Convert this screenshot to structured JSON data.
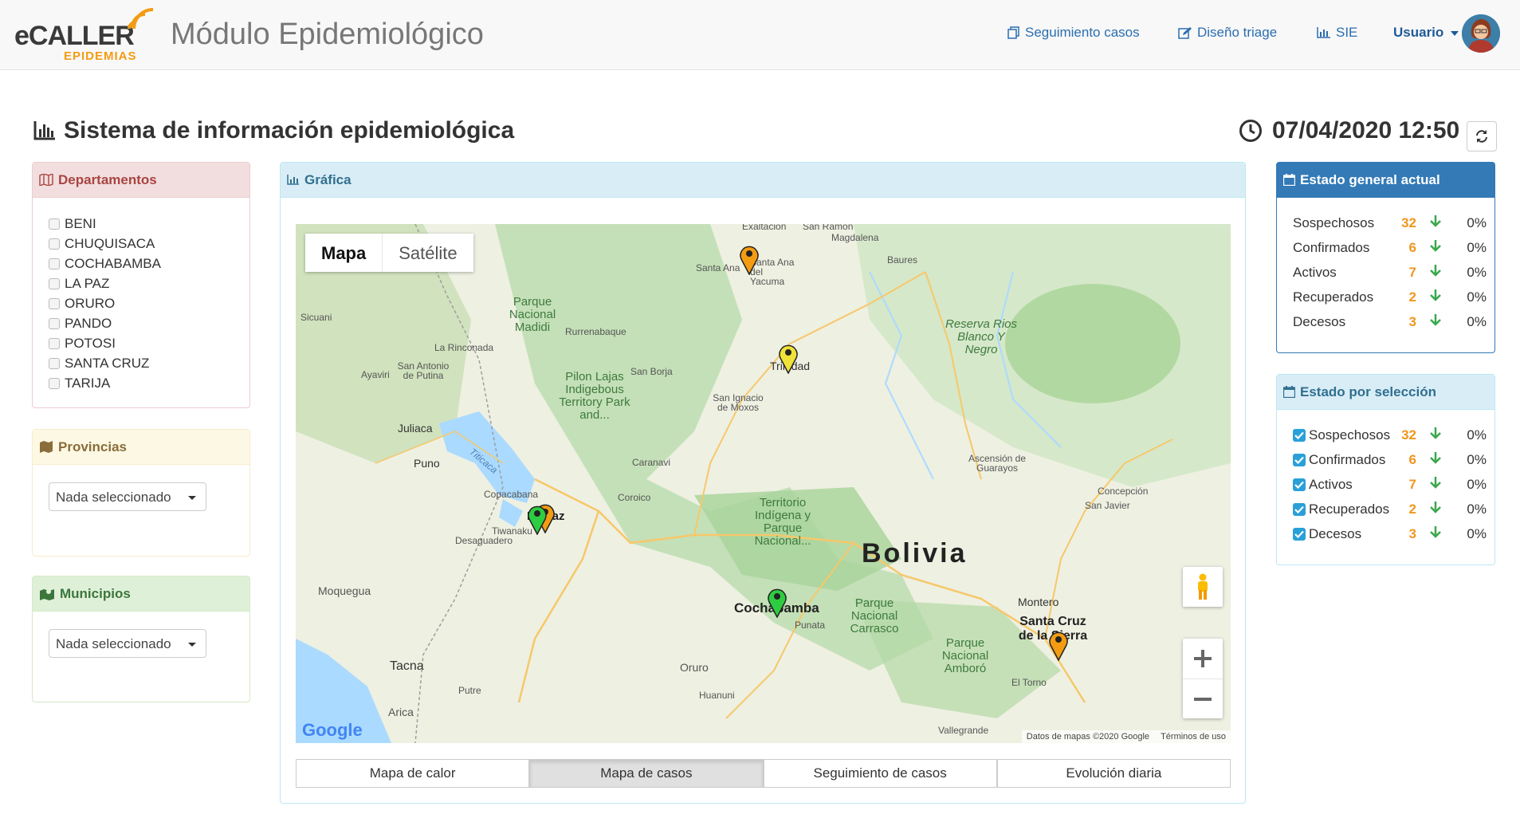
{
  "header": {
    "logo_text": "eCALLER",
    "logo_sub": "EPIDEMIAS",
    "app_title": "Módulo Epidemiológico",
    "nav": [
      {
        "label": "Seguimiento casos",
        "icon": "copy-icon"
      },
      {
        "label": "Diseño triage",
        "icon": "edit-icon"
      },
      {
        "label": "SIE",
        "icon": "bar-chart-icon"
      }
    ],
    "user_label": "Usuario"
  },
  "page": {
    "title": "Sistema de información epidemiológica",
    "datetime": "07/04/2020 12:50"
  },
  "departamentos": {
    "title": "Departamentos",
    "items": [
      "BENI",
      "CHUQUISACA",
      "COCHABAMBA",
      "LA PAZ",
      "ORURO",
      "PANDO",
      "POTOSI",
      "SANTA CRUZ",
      "TARIJA"
    ]
  },
  "provincias": {
    "title": "Provincias",
    "placeholder": "Nada seleccionado"
  },
  "municipios": {
    "title": "Municipios",
    "placeholder": "Nada seleccionado"
  },
  "grafica": {
    "title": "Gráfica",
    "map_types": [
      "Mapa",
      "Satélite"
    ],
    "map_country_label": "Bolivia",
    "map_attribution": "Datos de mapas ©2020 Google",
    "map_terms": "Términos de uso",
    "google_logo": "Google",
    "place_labels": [
      "Santa Ana",
      "Santa Ana del Yacuma",
      "Magdalena",
      "Baures",
      "Trinidad",
      "San Borja",
      "San Ignacio de Moxos",
      "Reserva Rios Blanco Y Negro",
      "Parque Nacional Madidi",
      "Rurrenabaque",
      "Sicuani",
      "La Rinconada",
      "San Antonio de Putina",
      "Ayaviri",
      "Juliaca",
      "Puno",
      "Titicaca",
      "Pilon Lajas Indigebous Territory Park and...",
      "Caranavi",
      "Coroico",
      "Copacabana",
      "La Paz",
      "Tiwanaku",
      "Desaguadero",
      "Territorio Indígena y Parque Nacional...",
      "Cochabamba",
      "Punata",
      "Parque Nacional Carrasco",
      "Parque Nacional Amboró",
      "Santa Cruz de la Sierra",
      "Montero",
      "El Torno",
      "Ascensión de Guarayos",
      "Concepción",
      "San Javier",
      "Moquegua",
      "Tacna",
      "Arica",
      "Putre",
      "Oruro",
      "Huanuni",
      "Vallegrande",
      "Exaltación",
      "San Ramón"
    ],
    "markers": [
      {
        "place": "Santa Ana",
        "color": "#f39c12"
      },
      {
        "place": "Trinidad",
        "color": "#f1e23a"
      },
      {
        "place": "La Paz",
        "color": "#f39c12"
      },
      {
        "place": "La Paz",
        "color": "#2ecc40"
      },
      {
        "place": "Cochabamba",
        "color": "#2ecc40"
      },
      {
        "place": "Santa Cruz de la Sierra",
        "color": "#f39c12"
      }
    ],
    "tabs": [
      "Mapa de calor",
      "Mapa de casos",
      "Seguimiento de casos",
      "Evolución diaria"
    ],
    "active_tab": "Mapa de casos"
  },
  "estado_general": {
    "title": "Estado general actual",
    "rows": [
      {
        "label": "Sospechosos",
        "value": "32",
        "pct": "0%"
      },
      {
        "label": "Confirmados",
        "value": "6",
        "pct": "0%"
      },
      {
        "label": "Activos",
        "value": "7",
        "pct": "0%"
      },
      {
        "label": "Recuperados",
        "value": "2",
        "pct": "0%"
      },
      {
        "label": "Decesos",
        "value": "3",
        "pct": "0%"
      }
    ]
  },
  "estado_seleccion": {
    "title": "Estado por selección",
    "rows": [
      {
        "label": "Sospechosos",
        "value": "32",
        "pct": "0%",
        "checked": true
      },
      {
        "label": "Confirmados",
        "value": "6",
        "pct": "0%",
        "checked": true
      },
      {
        "label": "Activos",
        "value": "7",
        "pct": "0%",
        "checked": true
      },
      {
        "label": "Recuperados",
        "value": "2",
        "pct": "0%",
        "checked": true
      },
      {
        "label": "Decesos",
        "value": "3",
        "pct": "0%",
        "checked": true
      }
    ]
  },
  "colors": {
    "accent": "#337ab7",
    "value_orange": "#f0961e",
    "arrow_green": "#3aa84c",
    "checkbox_blue": "#2aa0d8"
  }
}
